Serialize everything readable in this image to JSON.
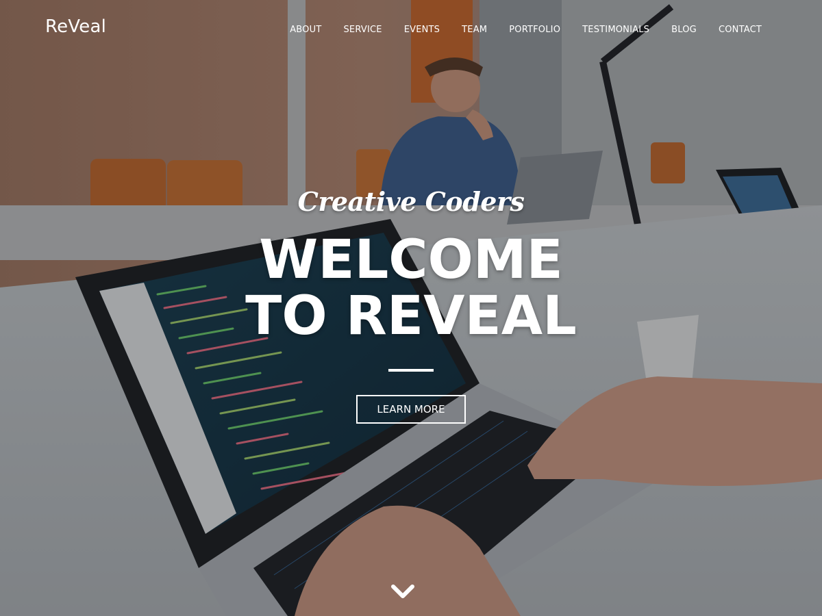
{
  "brand": {
    "logo_text": "ReVeal"
  },
  "nav": {
    "items": [
      {
        "label": "ABOUT"
      },
      {
        "label": "SERVICE"
      },
      {
        "label": "EVENTS"
      },
      {
        "label": "TEAM"
      },
      {
        "label": "PORTFOLIO"
      },
      {
        "label": "TESTIMONIALS"
      },
      {
        "label": "BLOG"
      },
      {
        "label": "CONTACT"
      }
    ]
  },
  "hero": {
    "tagline": "Creative Coders",
    "headline": "WELCOME TO REVEAL",
    "cta_label": "LEARN MORE",
    "scroll_icon": "chevron-down-icon"
  },
  "colors": {
    "text": "#ffffff",
    "overlay": "#14161a",
    "accent_orange": "#d9772d"
  }
}
